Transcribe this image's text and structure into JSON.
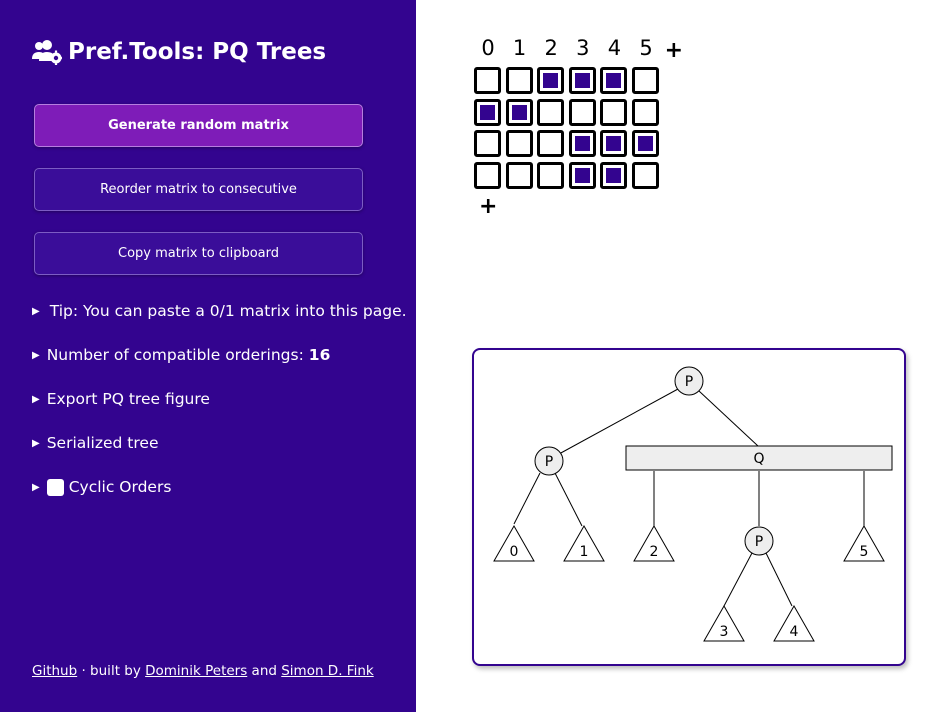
{
  "title": "Pref.Tools: PQ Trees",
  "buttons": {
    "generate": "Generate random matrix",
    "reorder": "Reorder matrix to consecutive",
    "copy": "Copy matrix to clipboard"
  },
  "details": {
    "tip": "Tip: You can paste a 0/1 matrix into this page.",
    "orderings_label": "Number of compatible orderings:",
    "orderings_value": "16",
    "export": "Export PQ tree figure",
    "serialized": "Serialized tree",
    "cyclic": "Cyclic Orders"
  },
  "footer": {
    "github": "Github",
    "built_by": " · built by ",
    "author1": "Dominik Peters",
    "and": " and ",
    "author2": "Simon D. Fink"
  },
  "matrix": {
    "columns": [
      "0",
      "1",
      "2",
      "3",
      "4",
      "5"
    ],
    "add_column": "+",
    "add_row": "+",
    "rows": [
      [
        0,
        0,
        1,
        1,
        1,
        0
      ],
      [
        1,
        1,
        0,
        0,
        0,
        0
      ],
      [
        0,
        0,
        0,
        1,
        1,
        1
      ],
      [
        0,
        0,
        0,
        1,
        1,
        0
      ]
    ]
  },
  "tree": {
    "root": "P",
    "left_p": "P",
    "q_node": "Q",
    "inner_p": "P",
    "leaves": [
      "0",
      "1",
      "2",
      "3",
      "4",
      "5"
    ]
  },
  "colors": {
    "sidebar": "#33048f",
    "primary_button": "#7e1cb8",
    "cell_fill": "#33048f"
  }
}
